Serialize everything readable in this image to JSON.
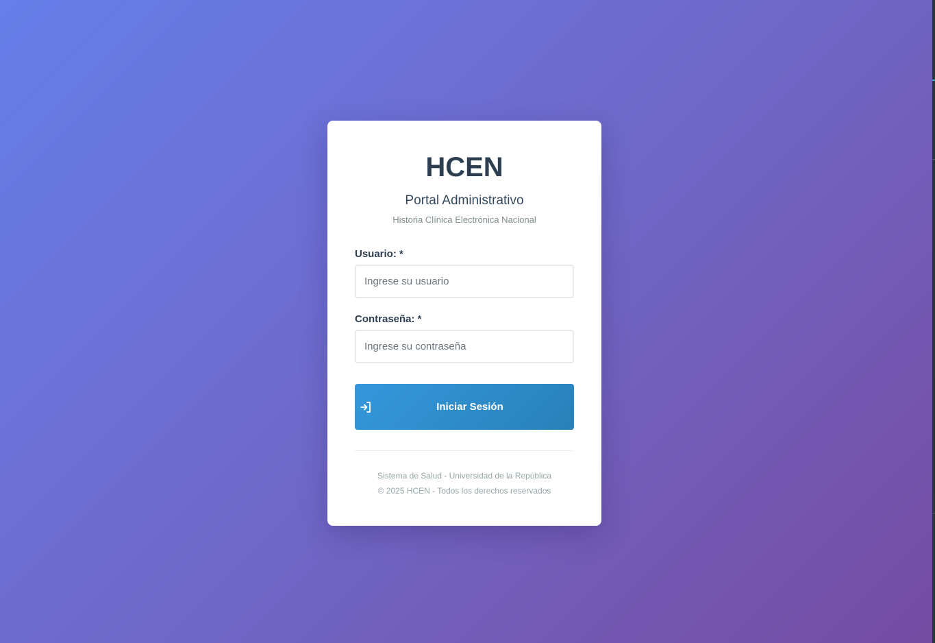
{
  "app": {
    "title": "HCEN",
    "subtitle": "Portal Administrativo",
    "description": "Historia Clínica Electrónica Nacional"
  },
  "form": {
    "username": {
      "label": "Usuario:",
      "required_mark": "*",
      "value": "",
      "placeholder": "Ingrese su usuario"
    },
    "password": {
      "label": "Contraseña:",
      "required_mark": "*",
      "value": "",
      "placeholder": "Ingrese su contraseña"
    },
    "submit": {
      "label": "Iniciar Sesión",
      "icon": "login-icon"
    }
  },
  "footer": {
    "line1": "Sistema de Salud - Universidad de la República",
    "line2": "© 2025 HCEN - Todos los derechos reservados"
  },
  "colors": {
    "background_start": "#667eea",
    "background_end": "#764ba2",
    "button_start": "#3498db",
    "button_end": "#2980b9",
    "title_text": "#2c3e50"
  }
}
